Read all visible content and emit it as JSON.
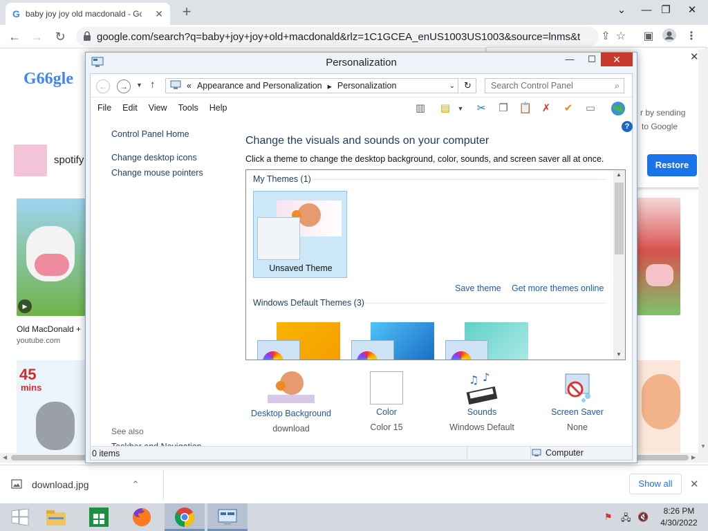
{
  "browser": {
    "tab_title": "baby joy joy old macdonald - Go",
    "url": "google.com/search?q=baby+joy+joy+old+macdonald&rlz=1C1GCEA_enUS1003US1003&source=lnms&tbm=is...",
    "google_logo": "G66gle",
    "results": {
      "spotify_label": "spotify",
      "video_title": "Old MacDonald +",
      "video_source": "youtube.com",
      "badge_45": "45",
      "badge_mins": "mins"
    },
    "restore_popup": {
      "text_line1": "r by sending",
      "text_line2": "to Google",
      "restore_label": "Restore"
    },
    "download": {
      "file_name": "download.jpg",
      "show_all_label": "Show all"
    }
  },
  "cp_window": {
    "title": "Personalization",
    "breadcrumb": {
      "prefix": "«",
      "part1": "Appearance and Personalization",
      "sep": "▸",
      "part2": "Personalization"
    },
    "search_placeholder": "Search Control Panel",
    "menu": {
      "file": "File",
      "edit": "Edit",
      "view": "View",
      "tools": "Tools",
      "help": "Help"
    },
    "left_nav": {
      "home": "Control Panel Home",
      "desktop_icons": "Change desktop icons",
      "mouse_pointers": "Change mouse pointers",
      "see_also": "See also",
      "taskbar_nav": "Taskbar and Navigation"
    },
    "heading": "Change the visuals and sounds on your computer",
    "subheading": "Click a theme to change the desktop background, color, sounds, and screen saver all at once.",
    "my_themes": "My Themes (1)",
    "unsaved_theme": "Unsaved Theme",
    "save_theme": "Save theme",
    "get_more": "Get more themes online",
    "default_themes": "Windows Default Themes (3)",
    "bottom": {
      "desktop_bg_title": "Desktop Background",
      "desktop_bg_value": "download",
      "color_title": "Color",
      "color_value": "Color 15",
      "sounds_title": "Sounds",
      "sounds_value": "Windows Default",
      "screensaver_title": "Screen Saver",
      "screensaver_value": "None"
    },
    "status": {
      "items": "0 items",
      "location": "Computer"
    }
  },
  "taskbar": {
    "time": "8:26 PM",
    "date": "4/30/2022"
  },
  "colors": {
    "accent": "#1a73e8",
    "close_red": "#c7392c",
    "link_blue": "#1f5aa6"
  }
}
